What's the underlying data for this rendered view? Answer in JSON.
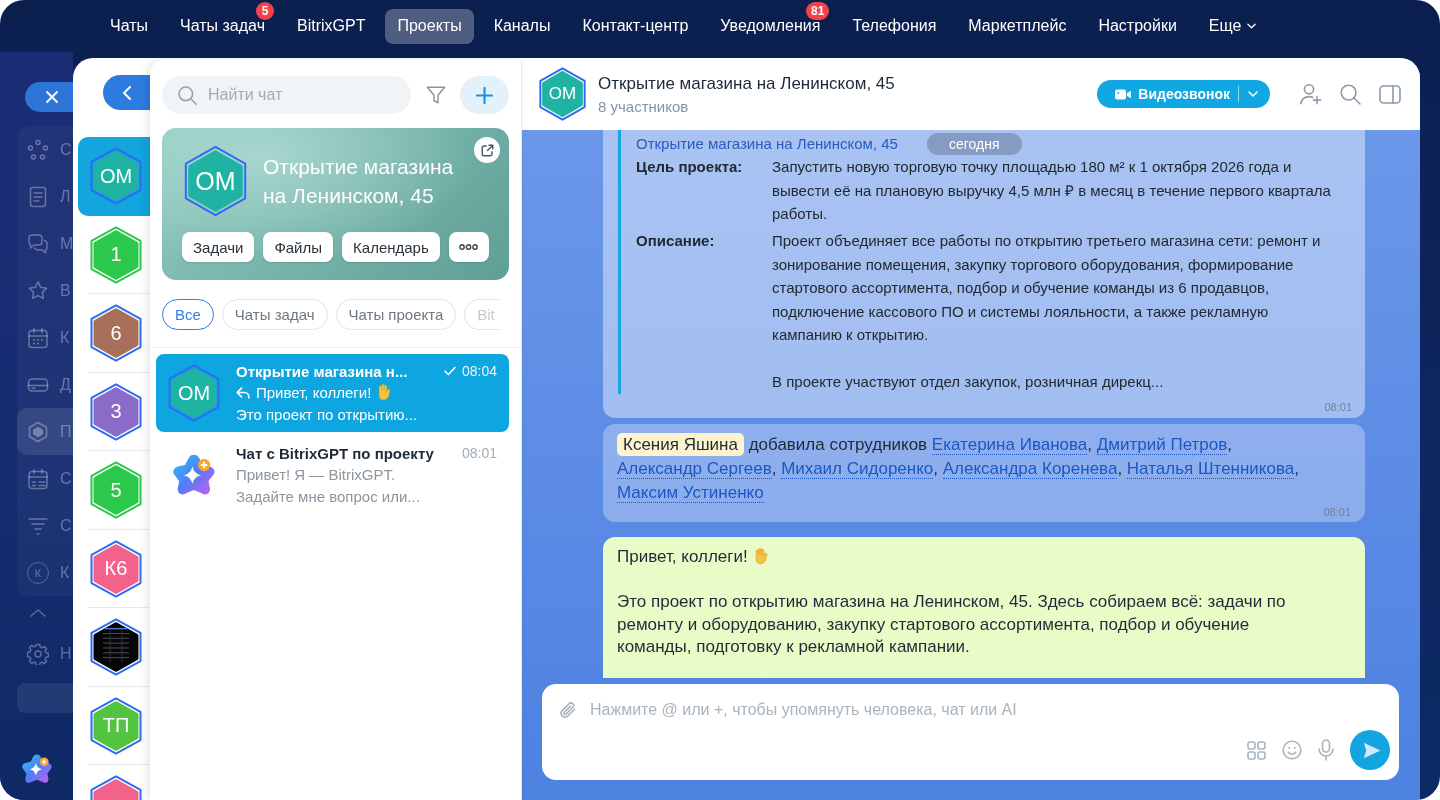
{
  "top_nav": {
    "items": [
      {
        "label": "Чаты",
        "selected": false
      },
      {
        "label": "Чаты задач",
        "selected": false,
        "counter": "5"
      },
      {
        "label": "BitrixGPT",
        "selected": false
      },
      {
        "label": "Проекты",
        "selected": true
      },
      {
        "label": "Каналы",
        "selected": false
      },
      {
        "label": "Контакт-центр",
        "selected": false
      },
      {
        "label": "Уведомления",
        "selected": false,
        "counter": "81"
      },
      {
        "label": "Телефония",
        "selected": false
      },
      {
        "label": "Маркетплейс",
        "selected": false
      },
      {
        "label": "Настройки",
        "selected": false
      },
      {
        "label": "Еще",
        "selected": false,
        "kind": "dropdown"
      }
    ]
  },
  "sidebar": {
    "items": [
      {
        "kind": "menu",
        "label": "С",
        "selected": false
      },
      {
        "kind": "menu",
        "label": "Л",
        "selected": false
      },
      {
        "kind": "menu",
        "label": "М",
        "selected": false
      },
      {
        "kind": "menu",
        "label": "В",
        "selected": false
      },
      {
        "kind": "menu",
        "label": "К",
        "selected": false
      },
      {
        "kind": "menu",
        "label": "Д",
        "selected": false
      },
      {
        "kind": "menu",
        "label": "П",
        "selected": true
      },
      {
        "kind": "menu",
        "label": "С",
        "selected": false
      },
      {
        "kind": "menu",
        "label": "С",
        "selected": false
      },
      {
        "kind": "user",
        "initial": "К",
        "label": "К",
        "selected": false
      },
      {
        "kind": "collapse"
      },
      {
        "kind": "menu",
        "label": "Н",
        "selected": false
      },
      {
        "kind": "button"
      }
    ]
  },
  "rail": {
    "items": [
      {
        "kind": "project",
        "initials": "ОМ",
        "color": "#1fb3a3",
        "selected": true
      },
      {
        "kind": "collab",
        "initials": "1",
        "color": "#2cc84b",
        "selected": false
      },
      {
        "kind": "project",
        "initials": "6",
        "color": "#a8705a",
        "selected": false
      },
      {
        "kind": "project",
        "initials": "3",
        "color": "#8a6cc8",
        "selected": false
      },
      {
        "kind": "collab",
        "initials": "5",
        "color": "#2cc84b",
        "selected": false
      },
      {
        "kind": "project",
        "initials": "К6",
        "color": "#f2628a",
        "selected": false
      },
      {
        "kind": "photo",
        "selected": false
      },
      {
        "kind": "project",
        "initials": "ТП",
        "color": "#52c43f",
        "selected": false
      },
      {
        "kind": "project",
        "color": "#f2628a",
        "selected": false
      }
    ]
  },
  "chat_list": {
    "search": {
      "placeholder": "Найти чат"
    },
    "project_card": {
      "initials": "ОМ",
      "title": "Открытие магазина на Ленинском, 45",
      "buttons": [
        "Задачи",
        "Файлы",
        "Календарь"
      ]
    },
    "filters": [
      {
        "label": "Все",
        "selected": true
      },
      {
        "label": "Чаты задач",
        "selected": false
      },
      {
        "label": "Чаты проекта",
        "selected": false
      },
      {
        "label": "Bit",
        "selected": false
      }
    ],
    "chats": [
      {
        "kind": "project",
        "initials": "ОМ",
        "title": "Открытие магазина н...",
        "time": "08:04",
        "sent": true,
        "preview": "Привет, коллеги!",
        "preview_after_emoji": "Это проект по открытию...",
        "selected": true
      },
      {
        "kind": "bot",
        "title": "Чат с BitrixGPT по проекту",
        "time": "08:01",
        "sent": false,
        "preview": "Привет! Я — BitrixGPT.\nЗадайте мне вопрос или...",
        "selected": false
      }
    ]
  },
  "chat": {
    "header": {
      "initials": "ОМ",
      "title": "Открытие магазина на Ленинском, 45",
      "subtitle": "8 участников",
      "video_call": "Видеозвонок"
    },
    "date_divider": "сегодня",
    "messages": [
      {
        "kind": "quote",
        "title": "Открытие магазина на Ленинском, 45",
        "fields": [
          {
            "label": "Цель проекта:",
            "paragraphs": [
              "Запустить новую торговую точку площадью 180 м² к 1 октября 2026 года и вывести её на плановую выручку 4,5 млн ₽ в месяц в течение первого квартала работы."
            ]
          },
          {
            "label": "Описание:",
            "paragraphs": [
              "Проект объединяет все работы по открытию третьего магазина сети: ремонт и зонирование помещения, закупку торгового оборудования, формирование стартового ассортимента, подбор и обучение команды из 6 продавцов, подключение кассового ПО и системы лояльности, а также рекламную кампанию к открытию.",
              "В проекте участвуют отдел закупок, розничная дирекц..."
            ]
          }
        ],
        "time": "08:01"
      },
      {
        "kind": "system",
        "author": "Ксения Яшина",
        "action": "добавила сотрудников",
        "links": [
          "Екатерина Иванова",
          "Дмитрий Петров",
          "Александр Сергеев",
          "Михаил Сидоренко",
          "Александра Коренева",
          "Наталья Штенникова",
          "Максим Устиненко"
        ],
        "separator": ",",
        "time": "08:01"
      },
      {
        "kind": "text",
        "greeting": "Привет, коллеги!",
        "text": "Это проект по открытию магазина на Ленинском, 45. Здесь собираем всё: задачи по ремонту и оборудованию, закупку стартового ассортимента, подбор и обучение команды, подготовку к рекламной кампании."
      }
    ],
    "composer": {
      "placeholder": "Нажмите @ или +, чтобы упомянуть человека, чат или AI"
    }
  }
}
